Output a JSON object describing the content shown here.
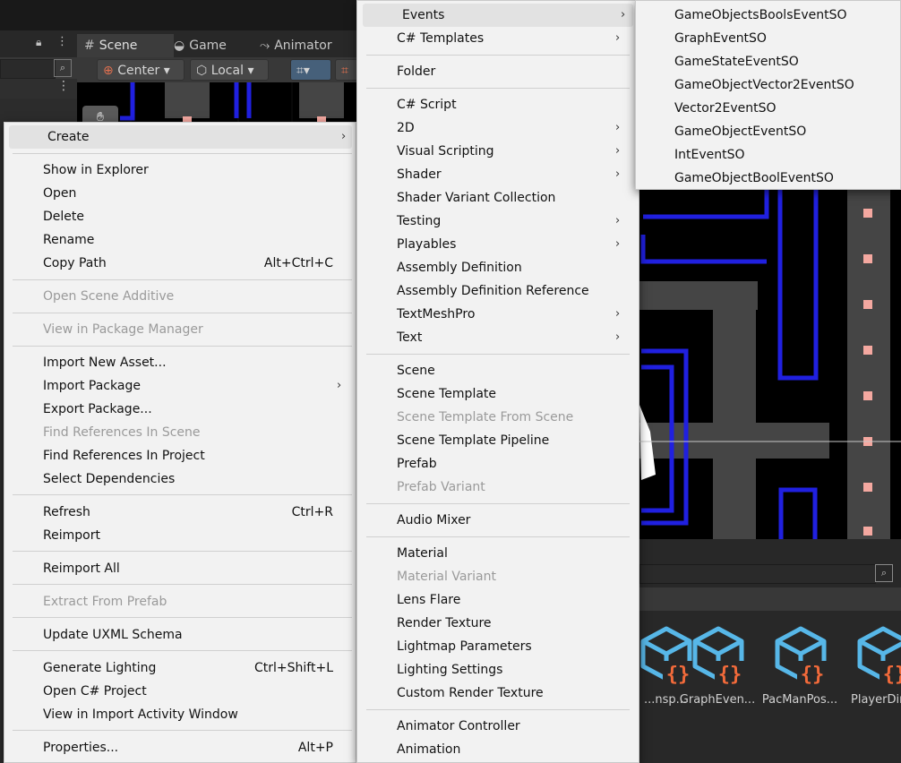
{
  "editor": {
    "tabs": [
      {
        "label": "Scene",
        "icon": "grid-icon"
      },
      {
        "label": "Game",
        "icon": "gamepad-icon"
      },
      {
        "label": "Animator",
        "icon": "animator-icon"
      }
    ],
    "toolbar": {
      "pivot_label": "Center",
      "space_label": "Local"
    }
  },
  "assets": [
    {
      "label": "...nsp..."
    },
    {
      "label": "GraphEven..."
    },
    {
      "label": "PacManPos..."
    },
    {
      "label": "PlayerDir"
    }
  ],
  "context_menu": {
    "items": [
      {
        "label": "Create",
        "shortcut": "",
        "arrow": "›",
        "highlight": true
      },
      {
        "label": "Show in Explorer",
        "shortcut": ""
      },
      {
        "label": "Open",
        "shortcut": ""
      },
      {
        "label": "Delete",
        "shortcut": ""
      },
      {
        "label": "Rename",
        "shortcut": ""
      },
      {
        "label": "Copy Path",
        "shortcut": "Alt+Ctrl+C"
      },
      {
        "label": "Open Scene Additive",
        "shortcut": "",
        "disabled": true
      },
      {
        "label": "View in Package Manager",
        "shortcut": "",
        "disabled": true
      },
      {
        "label": "Import New Asset...",
        "shortcut": ""
      },
      {
        "label": "Import Package",
        "shortcut": "",
        "arrow": "›"
      },
      {
        "label": "Export Package...",
        "shortcut": ""
      },
      {
        "label": "Find References In Scene",
        "shortcut": "",
        "disabled": true
      },
      {
        "label": "Find References In Project",
        "shortcut": ""
      },
      {
        "label": "Select Dependencies",
        "shortcut": ""
      },
      {
        "label": "Refresh",
        "shortcut": "Ctrl+R"
      },
      {
        "label": "Reimport",
        "shortcut": ""
      },
      {
        "label": "Reimport All",
        "shortcut": ""
      },
      {
        "label": "Extract From Prefab",
        "shortcut": "",
        "disabled": true
      },
      {
        "label": "Update UXML Schema",
        "shortcut": ""
      },
      {
        "label": "Generate Lighting",
        "shortcut": "Ctrl+Shift+L"
      },
      {
        "label": "Open C# Project",
        "shortcut": ""
      },
      {
        "label": "View in Import Activity Window",
        "shortcut": ""
      },
      {
        "label": "Properties...",
        "shortcut": "Alt+P"
      }
    ]
  },
  "create_submenu": {
    "items": [
      {
        "label": "Events",
        "arrow": "›",
        "highlight": true
      },
      {
        "label": "C# Templates",
        "arrow": "›"
      },
      {
        "label": "Folder"
      },
      {
        "label": "C# Script"
      },
      {
        "label": "2D",
        "arrow": "›"
      },
      {
        "label": "Visual Scripting",
        "arrow": "›"
      },
      {
        "label": "Shader",
        "arrow": "›"
      },
      {
        "label": "Shader Variant Collection"
      },
      {
        "label": "Testing",
        "arrow": "›"
      },
      {
        "label": "Playables",
        "arrow": "›"
      },
      {
        "label": "Assembly Definition"
      },
      {
        "label": "Assembly Definition Reference"
      },
      {
        "label": "TextMeshPro",
        "arrow": "›"
      },
      {
        "label": "Text",
        "arrow": "›"
      },
      {
        "label": "Scene"
      },
      {
        "label": "Scene Template"
      },
      {
        "label": "Scene Template From Scene",
        "disabled": true
      },
      {
        "label": "Scene Template Pipeline"
      },
      {
        "label": "Prefab"
      },
      {
        "label": "Prefab Variant",
        "disabled": true
      },
      {
        "label": "Audio Mixer"
      },
      {
        "label": "Material"
      },
      {
        "label": "Material Variant",
        "disabled": true
      },
      {
        "label": "Lens Flare"
      },
      {
        "label": "Render Texture"
      },
      {
        "label": "Lightmap Parameters"
      },
      {
        "label": "Lighting Settings"
      },
      {
        "label": "Custom Render Texture"
      },
      {
        "label": "Animator Controller"
      },
      {
        "label": "Animation"
      }
    ]
  },
  "events_submenu": {
    "items": [
      {
        "label": "GameObjectsBoolsEventSO"
      },
      {
        "label": "GraphEventSO"
      },
      {
        "label": "GameStateEventSO"
      },
      {
        "label": "GameObjectVector2EventSO"
      },
      {
        "label": "Vector2EventSO"
      },
      {
        "label": "GameObjectEventSO"
      },
      {
        "label": "IntEventSO"
      },
      {
        "label": "GameObjectBoolEventSO"
      }
    ]
  },
  "colors": {
    "menu_bg": "#f2f2f2",
    "menu_highlight": "#e2e2e2",
    "disabled_text": "#9a9a9a",
    "maze_wall": "#2020e0",
    "pellet": "#f4a8a0",
    "asset_icon": "#57b7e8",
    "asset_braces": "#f26a3a"
  }
}
